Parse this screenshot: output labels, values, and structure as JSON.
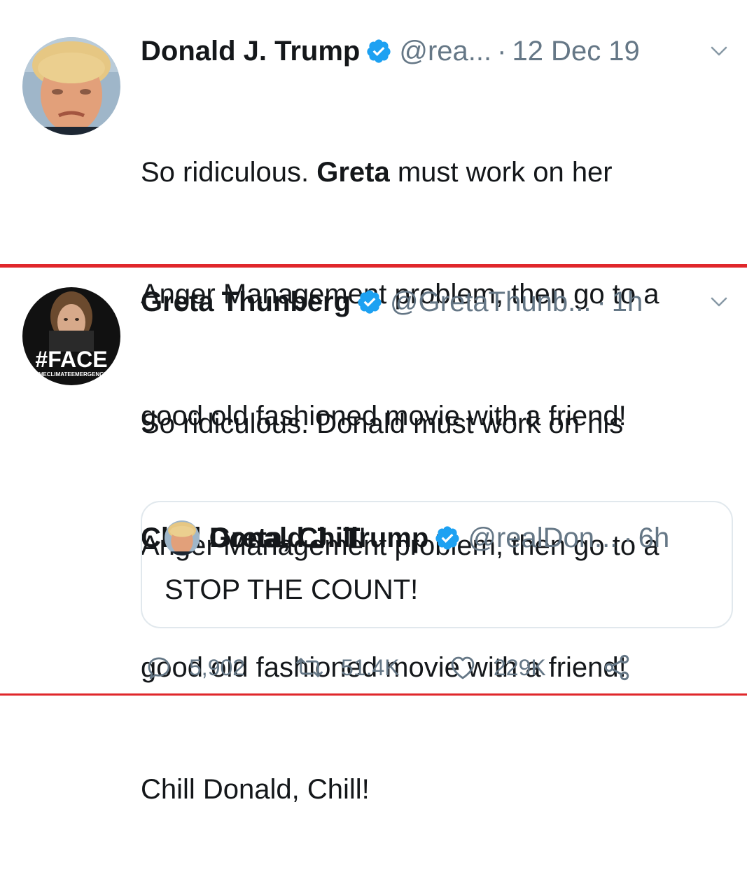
{
  "tweet1": {
    "name": "Donald J. Trump",
    "handle": "@rea...",
    "dot": "·",
    "time": "12 Dec 19",
    "body_lines": [
      {
        "pre": "So ridiculous. ",
        "bold": "Greta",
        "post": " must work on her"
      },
      {
        "pre": "Anger Management problem, then go to a",
        "bold": "",
        "post": ""
      },
      {
        "pre": "good old fashioned movie with a friend!",
        "bold": "",
        "post": ""
      },
      {
        "pre": "",
        "bold": "Chill Greta, Chill",
        "post": "!"
      }
    ]
  },
  "tweet2": {
    "name": "Greta Thunberg",
    "handle": "@GretaThunb...",
    "dot": "·",
    "time": "1h",
    "avatar_overlay": "#FACE",
    "avatar_subtitle": "THECLIMATEEMERGENCY",
    "body_lines": [
      "So ridiculous. Donald must work on his",
      "Anger Management problem, then go to a",
      "good old fashioned movie with a friend!",
      "Chill Donald, Chill!"
    ],
    "quote": {
      "name": "Donald J. Trump",
      "handle": "@realDon...",
      "dot": "·",
      "time": "6h",
      "text": "STOP THE COUNT!"
    },
    "actions": {
      "replies": "5,902",
      "retweets": "51.4K",
      "likes": "229K"
    }
  },
  "colors": {
    "verified": "#1da1f2",
    "muted": "#657786",
    "separator": "#e0272b",
    "border": "#e1e8ed"
  },
  "icons": [
    "verified-badge-icon",
    "chevron-down-icon",
    "reply-icon",
    "retweet-icon",
    "like-icon",
    "share-icon"
  ]
}
